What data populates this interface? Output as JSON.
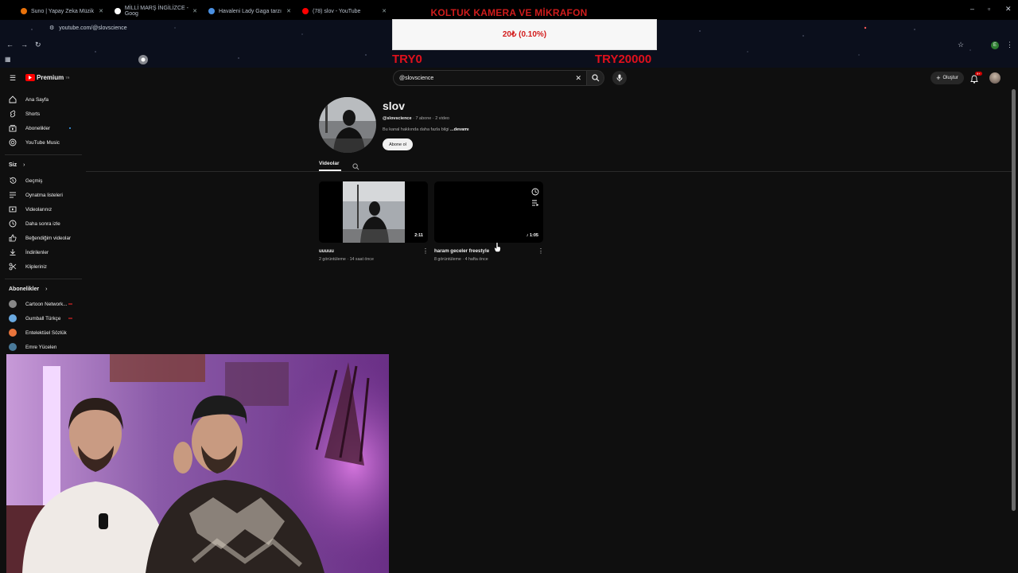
{
  "overlay": {
    "title": "KOLTUK KAMERA VE MİKRAFON",
    "donation_amount": "20₺ (0.10%)",
    "try_min": "TRY0",
    "try_max": "TRY20000"
  },
  "browser": {
    "tabs": [
      {
        "label": "Suno | Yapay Zeka Müzik",
        "color": "#e8710a"
      },
      {
        "label": "MİLLİ MARŞ İNGİLİZCE - Goog",
        "color": "#ffffff"
      },
      {
        "label": "Havaleni Lady Gaga tarzı",
        "color": "#4a90e2"
      },
      {
        "label": "(78) slov - YouTube",
        "color": "#ff0000"
      }
    ],
    "url": "youtube.com/@slovscience"
  },
  "header": {
    "logo_text": "Premium",
    "logo_sup": "TR",
    "search_value": "@slovscience",
    "create_label": "Oluştur",
    "notif_badge": "9+"
  },
  "sidebar": {
    "main": [
      {
        "label": "Ana Sayfa",
        "icon": "home-icon"
      },
      {
        "label": "Shorts",
        "icon": "shorts-icon"
      },
      {
        "label": "Abonelikler",
        "icon": "subscriptions-icon"
      },
      {
        "label": "YouTube Music",
        "icon": "music-icon"
      }
    ],
    "you_heading": "Siz",
    "you": [
      {
        "label": "Geçmiş",
        "icon": "history-icon"
      },
      {
        "label": "Oynatma listeleri",
        "icon": "playlists-icon"
      },
      {
        "label": "Videolarınız",
        "icon": "your-videos-icon"
      },
      {
        "label": "Daha sonra izle",
        "icon": "watch-later-icon"
      },
      {
        "label": "Beğendiğim videolar",
        "icon": "liked-icon"
      },
      {
        "label": "İndirilenler",
        "icon": "download-icon"
      },
      {
        "label": "Klipleriniz",
        "icon": "clips-icon"
      }
    ],
    "subs_heading": "Abonelikler",
    "subs": [
      {
        "label": "Cartoon Network...",
        "color": "#888888"
      },
      {
        "label": "Gumball Türkçe",
        "color": "#6aa9e0"
      },
      {
        "label": "Entelektüel Sözlük",
        "color": "#e8743b"
      },
      {
        "label": "Emre Yücelen",
        "color": "#4a7a9a"
      }
    ]
  },
  "channel": {
    "name": "slov",
    "handle": "@slovscience",
    "meta": " · 7 abone · 2 video",
    "desc": "Bu kanal hakkında daha fazla bilgi ",
    "desc_more": "...devamı",
    "subscribe_label": "Abone ol",
    "tab_videos": "Videolar"
  },
  "videos": [
    {
      "title": "uuuuu",
      "meta": "2 görüntüleme · 14 saat önce",
      "duration": "2:11"
    },
    {
      "title": "haram geceler freestyle",
      "meta": "8 görüntüleme · 4 hafta önce",
      "duration": "1:05"
    }
  ]
}
